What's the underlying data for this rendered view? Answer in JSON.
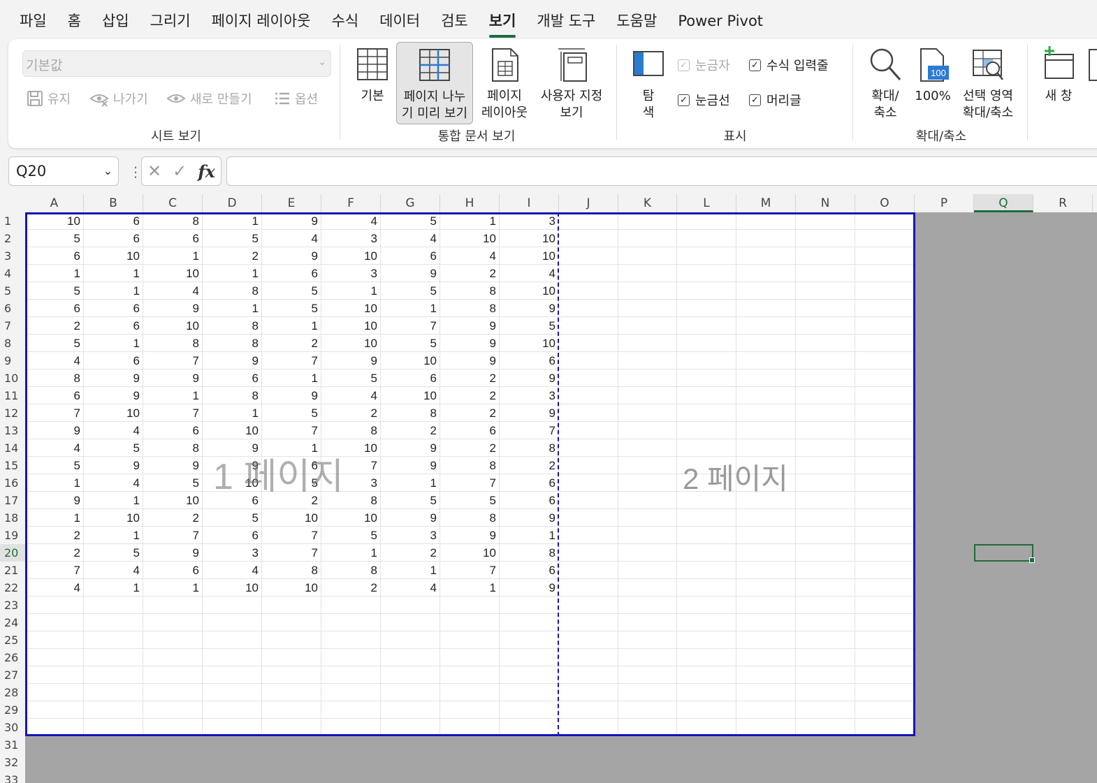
{
  "menu": {
    "tabs": [
      "파일",
      "홈",
      "삽입",
      "그리기",
      "페이지 레이아웃",
      "수식",
      "데이터",
      "검토",
      "보기",
      "개발 도구",
      "도움말",
      "Power Pivot"
    ],
    "active": "보기"
  },
  "ribbon": {
    "sheet_view": {
      "dropdown_value": "기본값",
      "keep_label": "유지",
      "exit_label": "나가기",
      "new_label": "새로 만들기",
      "options_label": "옵션",
      "group_label": "시트 보기"
    },
    "workbook_views": {
      "normal_label": "기본",
      "page_break_label_1": "페이지 나누",
      "page_break_label_2": "기 미리 보기",
      "page_layout_label_1": "페이지",
      "page_layout_label_2": "레이아웃",
      "custom_label_1": "사용자 지정",
      "custom_label_2": "보기",
      "group_label": "통합 문서 보기"
    },
    "show": {
      "nav_label_1": "탐",
      "nav_label_2": "색",
      "ruler_label": "눈금자",
      "formula_bar_label": "수식 입력줄",
      "gridlines_label": "눈금선",
      "headings_label": "머리글",
      "group_label": "표시"
    },
    "zoom": {
      "zoom_label_1": "확대/",
      "zoom_label_2": "축소",
      "zoom100_label": "100%",
      "zoom100_badge": "100",
      "zoom_sel_label_1": "선택 영역",
      "zoom_sel_label_2": "확대/축소",
      "group_label": "확대/축소"
    },
    "window": {
      "new_window_label": "새 창"
    }
  },
  "formula_bar": {
    "name_box": "Q20",
    "cancel_glyph": "✕",
    "enter_glyph": "✓",
    "fx_label": "fx",
    "formula": ""
  },
  "sheet": {
    "columns": [
      "A",
      "B",
      "C",
      "D",
      "E",
      "F",
      "G",
      "H",
      "I",
      "J",
      "K",
      "L",
      "M",
      "N",
      "O",
      "P",
      "Q",
      "R"
    ],
    "row_count": 33,
    "selected_cell": "Q20",
    "page_labels": [
      "1 페이지",
      "2 페이지"
    ],
    "data": [
      [
        10,
        6,
        8,
        1,
        9,
        4,
        5,
        1,
        3
      ],
      [
        5,
        6,
        6,
        5,
        4,
        3,
        4,
        10,
        10
      ],
      [
        6,
        10,
        1,
        2,
        9,
        10,
        6,
        4,
        10
      ],
      [
        1,
        1,
        10,
        1,
        6,
        3,
        9,
        2,
        4
      ],
      [
        5,
        1,
        4,
        8,
        5,
        1,
        5,
        8,
        10
      ],
      [
        6,
        6,
        9,
        1,
        5,
        10,
        1,
        8,
        9
      ],
      [
        2,
        6,
        10,
        8,
        1,
        10,
        7,
        9,
        5
      ],
      [
        5,
        1,
        8,
        8,
        2,
        10,
        5,
        9,
        10
      ],
      [
        4,
        6,
        7,
        9,
        7,
        9,
        10,
        9,
        6
      ],
      [
        8,
        9,
        9,
        6,
        1,
        5,
        6,
        2,
        9
      ],
      [
        6,
        9,
        1,
        8,
        9,
        4,
        10,
        2,
        3
      ],
      [
        7,
        10,
        7,
        1,
        5,
        2,
        8,
        2,
        9
      ],
      [
        9,
        4,
        6,
        10,
        7,
        8,
        2,
        6,
        7
      ],
      [
        4,
        5,
        8,
        9,
        1,
        10,
        9,
        2,
        8
      ],
      [
        5,
        9,
        9,
        9,
        6,
        7,
        9,
        8,
        2
      ],
      [
        1,
        4,
        5,
        10,
        5,
        3,
        1,
        7,
        6
      ],
      [
        9,
        1,
        10,
        6,
        2,
        8,
        5,
        5,
        6
      ],
      [
        1,
        10,
        2,
        5,
        10,
        10,
        9,
        8,
        9
      ],
      [
        2,
        1,
        7,
        6,
        7,
        5,
        3,
        9,
        1
      ],
      [
        2,
        5,
        9,
        3,
        7,
        1,
        2,
        10,
        8
      ],
      [
        7,
        4,
        6,
        4,
        8,
        8,
        1,
        7,
        6
      ],
      [
        4,
        1,
        1,
        10,
        10,
        2,
        4,
        1,
        9
      ]
    ]
  }
}
